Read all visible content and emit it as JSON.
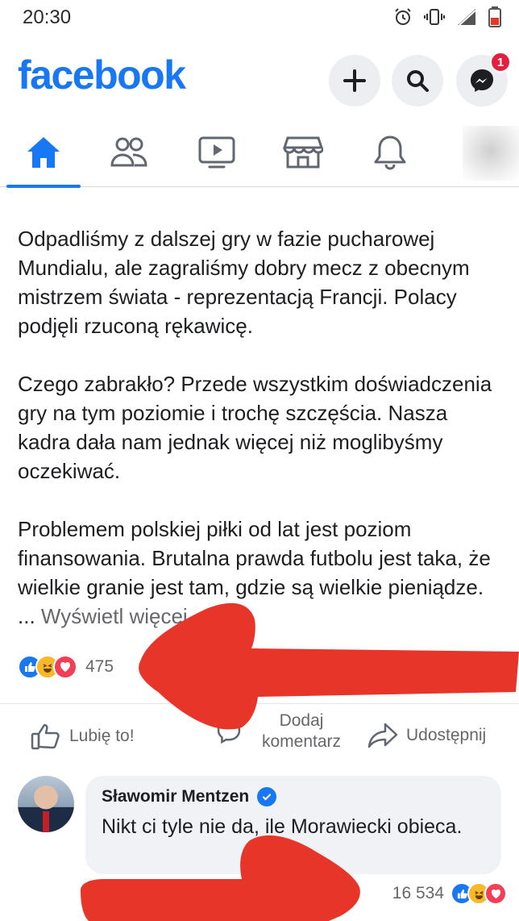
{
  "status_bar": {
    "time": "20:30",
    "icons": [
      "alarm-icon",
      "vibrate-icon",
      "signal-lte-icon",
      "battery-icon"
    ]
  },
  "header": {
    "logo": "facebook",
    "buttons": [
      "create-icon",
      "search-icon",
      "messenger-icon"
    ],
    "messenger_badge": "1"
  },
  "nav": {
    "tabs": [
      "home-icon",
      "friends-icon",
      "watch-icon",
      "marketplace-icon",
      "notifications-icon",
      "menu-avatar"
    ],
    "active": "home"
  },
  "post": {
    "paragraphs": [
      "Odpadliśmy z dalszej gry w fazie pucharowej Mundialu, ale zagraliśmy dobry mecz z obecnym mistrzem świata - reprezentacją Francji. Polacy podjęli rzuconą rękawicę.",
      "Czego zabrakło? Przede wszystkim doświadczenia gry na tym poziomie i trochę szczęścia. Nasza kadra dała nam jednak więcej niż moglibyśmy oczekiwać.",
      "Problemem polskiej piłki od lat jest poziom finansowania. Brutalna prawda futbolu jest taka, że wielkie granie jest tam, gdzie są wielkie pieniądze. ..."
    ],
    "see_more": "Wyświetl więcej",
    "reaction_count": "475",
    "reaction_icons": [
      "like-icon",
      "haha-icon",
      "love-icon"
    ]
  },
  "actions": {
    "like": "Lubię to!",
    "comment": "Dodaj komentarz",
    "share": "Udostępnij"
  },
  "comment": {
    "author": "Sławomir Mentzen",
    "text": "Nikt ci tyle nie da, ile Morawiecki obieca.",
    "reaction_count": "16 534",
    "reaction_icons": [
      "like-icon",
      "haha-icon",
      "love-icon"
    ]
  },
  "colors": {
    "brand": "#1877f2",
    "arrow": "#e8352a",
    "secondary_text": "#65676b"
  }
}
